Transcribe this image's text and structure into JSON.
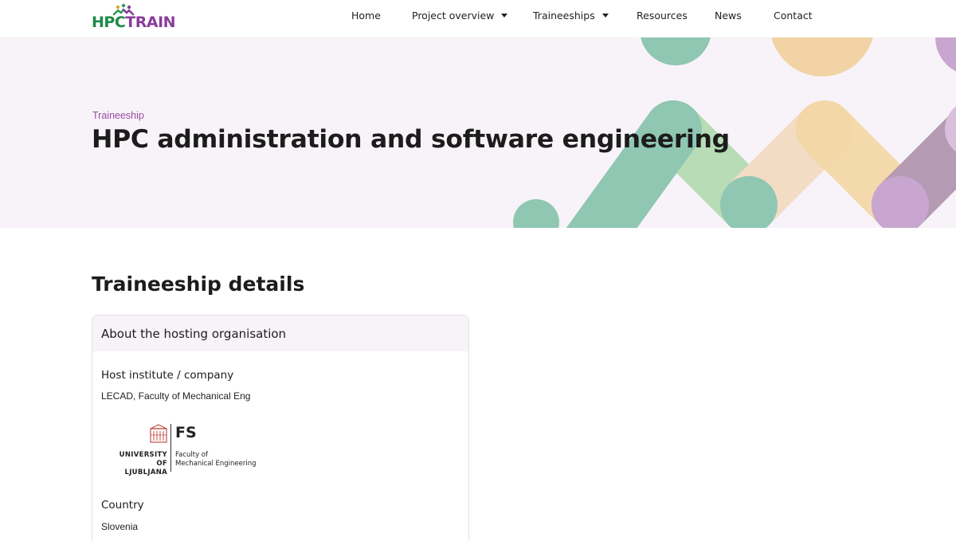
{
  "header": {
    "logo": {
      "hpc": "HPC",
      "train": "TRAIN"
    },
    "nav": [
      {
        "label": "Home",
        "has_dropdown": false
      },
      {
        "label": "Project overview",
        "has_dropdown": true
      },
      {
        "label": "Traineeships",
        "has_dropdown": true
      },
      {
        "label": "Resources",
        "has_dropdown": false
      },
      {
        "label": "News",
        "has_dropdown": false
      },
      {
        "label": "Contact",
        "has_dropdown": false
      }
    ]
  },
  "hero": {
    "eyebrow": "Traineeship",
    "title": "HPC administration and software engineering"
  },
  "main": {
    "section_title": "Traineeship details",
    "card": {
      "title": "About the hosting organisation",
      "host_label": "Host institute / company",
      "host_value": "LECAD, Faculty of Mechanical Eng",
      "host_logo": {
        "university_line1": "UNIVERSITY",
        "university_line2": "OF LJUBLJANA",
        "faculty_abbr": "FS",
        "faculty_line1": "Faculty of",
        "faculty_line2": "Mechanical Engineering"
      },
      "country_label": "Country",
      "country_value": "Slovenia"
    }
  },
  "colors": {
    "brand_green": "#1e8a4a",
    "brand_purple": "#8a3c9c",
    "hero_bg": "#f8f3f8",
    "eyebrow": "#9b4aa6"
  }
}
